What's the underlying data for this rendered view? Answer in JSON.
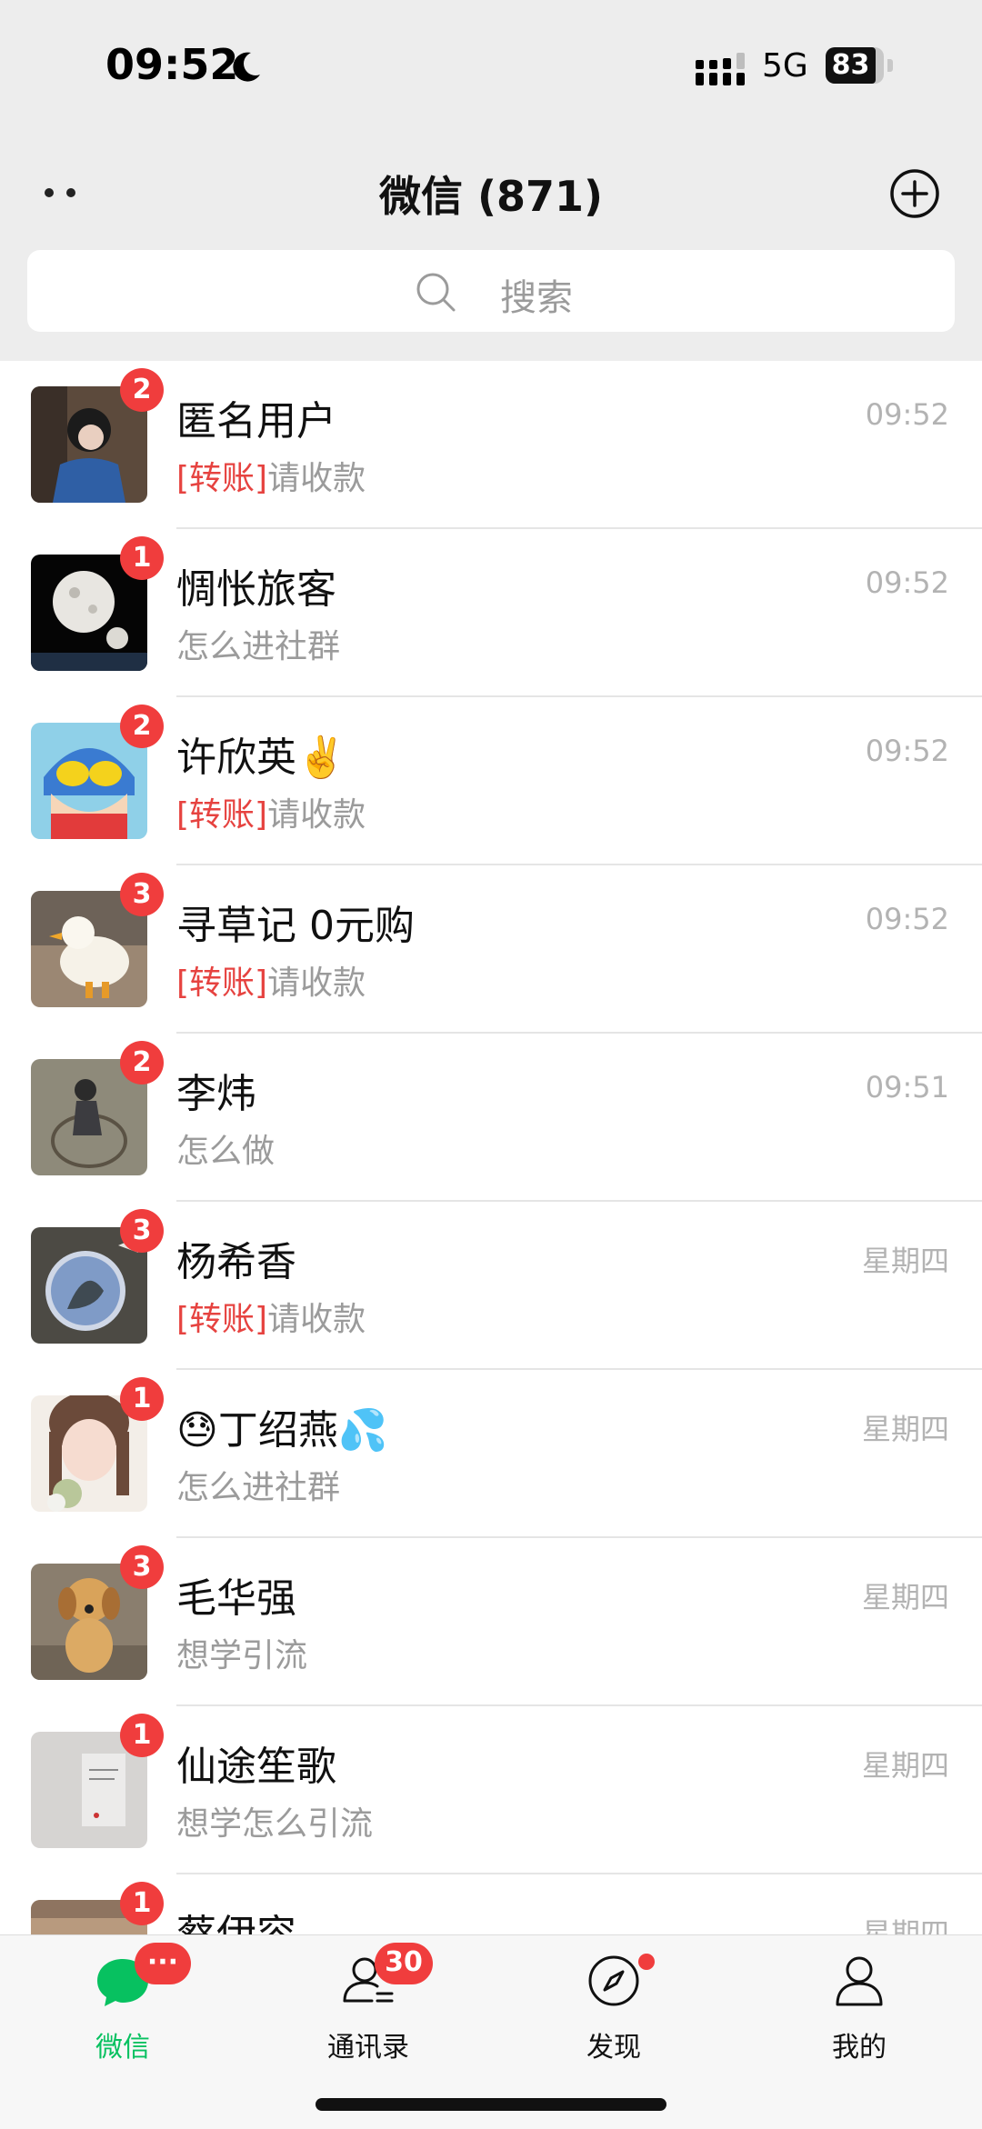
{
  "status_bar": {
    "time": "09:52",
    "network": "5G",
    "battery": "83"
  },
  "nav": {
    "title": "微信 (871)"
  },
  "search": {
    "placeholder": "搜索"
  },
  "chats": [
    {
      "name": "匿名用户",
      "badge": "2",
      "tag": "[转账]",
      "message": "请收款",
      "time": "09:52"
    },
    {
      "name": "惆怅旅客",
      "badge": "1",
      "tag": "",
      "message": "怎么进社群",
      "time": "09:52"
    },
    {
      "name": "许欣英✌️",
      "badge": "2",
      "tag": "[转账]",
      "message": "请收款",
      "time": "09:52"
    },
    {
      "name": "寻草记 0元购",
      "badge": "3",
      "tag": "[转账]",
      "message": "请收款",
      "time": "09:52"
    },
    {
      "name": "李炜",
      "badge": "2",
      "tag": "",
      "message": "怎么做",
      "time": "09:51"
    },
    {
      "name": "杨希香",
      "badge": "3",
      "tag": "[转账]",
      "message": "请收款",
      "time": "星期四"
    },
    {
      "name": "😓丁绍燕💦",
      "badge": "1",
      "tag": "",
      "message": "怎么进社群",
      "time": "星期四"
    },
    {
      "name": "毛华强",
      "badge": "3",
      "tag": "",
      "message": "想学引流",
      "time": "星期四"
    },
    {
      "name": "仙途笙歌",
      "badge": "1",
      "tag": "",
      "message": "想学怎么引流",
      "time": "星期四"
    },
    {
      "name": "蔡伊容",
      "badge": "1",
      "tag": "",
      "message": "",
      "time": "星期四"
    }
  ],
  "tabs": [
    {
      "label": "微信",
      "badge": "···",
      "active": true
    },
    {
      "label": "通讯录",
      "badge": "30"
    },
    {
      "label": "发现",
      "dot": true
    },
    {
      "label": "我的"
    }
  ],
  "colors": {
    "accent": "#07c160",
    "badge": "#f03d3d",
    "transfer_tag": "#e64340"
  },
  "icons": [
    "moon-icon",
    "signal-icon",
    "battery-icon",
    "more-icon",
    "add-icon",
    "search-icon",
    "chat-icon",
    "contacts-icon",
    "discover-icon",
    "me-icon"
  ]
}
